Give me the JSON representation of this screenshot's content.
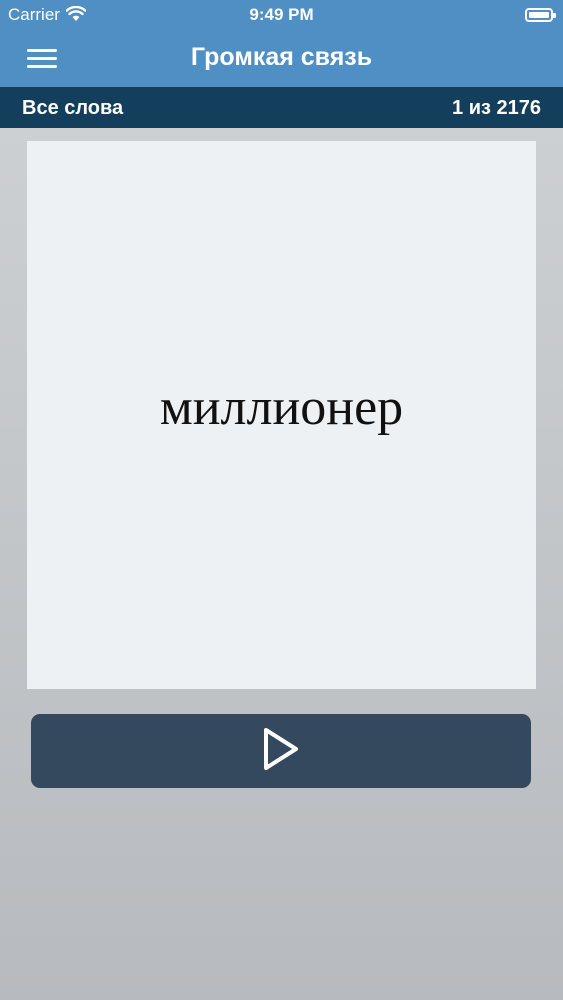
{
  "statusbar": {
    "carrier": "Carrier",
    "time": "9:49 PM"
  },
  "navbar": {
    "title": "Громкая связь",
    "menu_icon": "hamburger-menu-icon"
  },
  "subbar": {
    "filter_label": "Все слова",
    "counter": "1 из 2176"
  },
  "card": {
    "word": "миллионер"
  },
  "play_button": {
    "icon": "play-icon"
  },
  "colors": {
    "nav_blue": "#4f8fc4",
    "subbar_navy": "#143f5c",
    "button_slate": "#34495e",
    "card_bg": "#eef1f4"
  }
}
